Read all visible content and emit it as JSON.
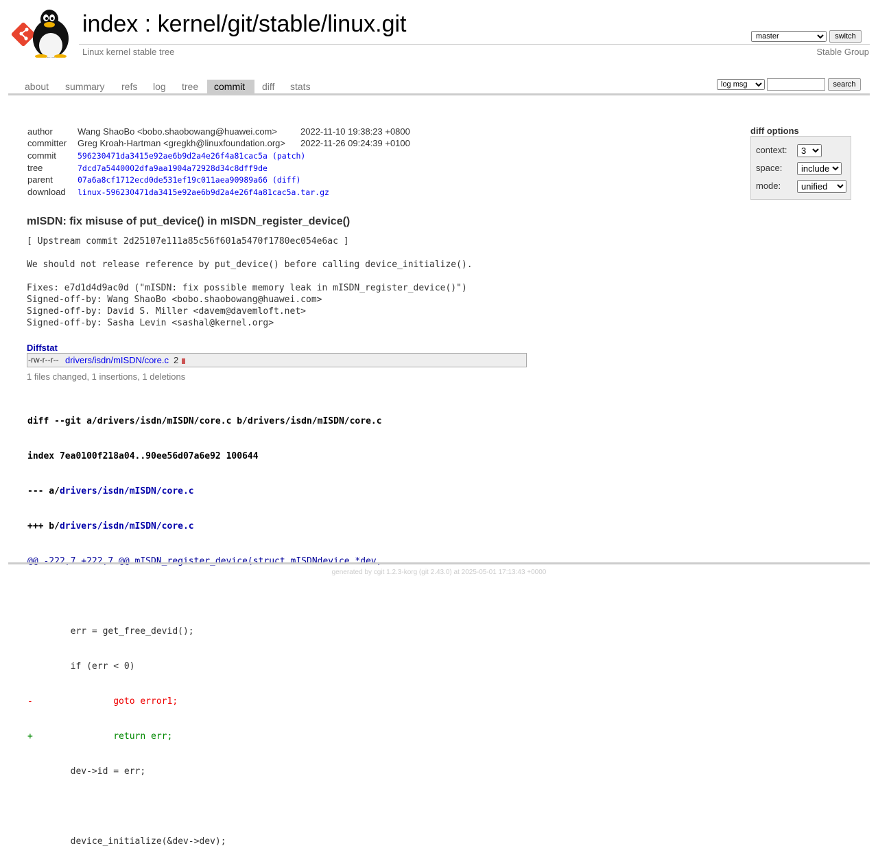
{
  "header": {
    "title_index": "index",
    "title_sep": " : ",
    "title_repo": "kernel/git/stable/linux.git",
    "subtitle": "Linux kernel stable tree",
    "owner": "Stable Group",
    "branch": "master",
    "switch_label": "switch"
  },
  "tabs": [
    {
      "label": "about"
    },
    {
      "label": "summary"
    },
    {
      "label": "refs"
    },
    {
      "label": "log"
    },
    {
      "label": "tree"
    },
    {
      "label": "commit"
    },
    {
      "label": "diff"
    },
    {
      "label": "stats"
    }
  ],
  "search": {
    "select_value": "log msg",
    "input_value": "",
    "button_label": "search"
  },
  "diff_options": {
    "title": "diff options",
    "context_label": "context:",
    "context_value": "3",
    "space_label": "space:",
    "space_value": "include",
    "mode_label": "mode:",
    "mode_value": "unified"
  },
  "commit_info": {
    "author_label": "author",
    "author": "Wang ShaoBo <bobo.shaobowang@huawei.com>",
    "author_date": "2022-11-10 19:38:23 +0800",
    "committer_label": "committer",
    "committer": "Greg Kroah-Hartman <gregkh@linuxfoundation.org>",
    "committer_date": "2022-11-26 09:24:39 +0100",
    "commit_label": "commit",
    "commit": "596230471da3415e92ae6b9d2a4e26f4a81cac5a",
    "patch": "(patch)",
    "tree_label": "tree",
    "tree": "7dcd7a5440002dfa9aa1904a72928d34c8dff9de",
    "parent_label": "parent",
    "parent": "07a6a8cf1712ecd0de531ef19c011aea90989a66",
    "parent_diff": "(diff)",
    "download_label": "download",
    "download": "linux-596230471da3415e92ae6b9d2a4e26f4a81cac5a.tar.gz"
  },
  "commit_subject": "mISDN: fix misuse of put_device() in mISDN_register_device()",
  "commit_message": "[ Upstream commit 2d25107e111a85c56f601a5470f1780ec054e6ac ]\n\nWe should not release reference by put_device() before calling device_initialize().\n\nFixes: e7d1d4d9ac0d (\"mISDN: fix possible memory leak in mISDN_register_device()\")\nSigned-off-by: Wang ShaoBo <bobo.shaobowang@huawei.com>\nSigned-off-by: David S. Miller <davem@davemloft.net>\nSigned-off-by: Sasha Levin <sashal@kernel.org>",
  "diffstat": {
    "header": "Diffstat",
    "mode": "-rw-r--r--",
    "file": "drivers/isdn/mISDN/core.c",
    "count": "2",
    "insertions": 1,
    "deletions": 1,
    "summary": "1 files changed, 1 insertions, 1 deletions"
  },
  "diff": {
    "line1": "diff --git a/drivers/isdn/mISDN/core.c b/drivers/isdn/mISDN/core.c",
    "line2": "index 7ea0100f218a04..90ee56d07a6e92 100644",
    "minus_prefix": "--- a/",
    "plus_prefix": "+++ b/",
    "file": "drivers/isdn/mISDN/core.c",
    "hunk": "@@ -222,7 +222,7 @@ mISDN_register_device(struct mISDNdevice *dev,",
    "body": [
      {
        "type": "ctx",
        "text": ""
      },
      {
        "type": "ctx",
        "text": "        err = get_free_devid();"
      },
      {
        "type": "ctx",
        "text": "        if (err < 0)"
      },
      {
        "type": "del",
        "text": "-               goto error1;"
      },
      {
        "type": "add",
        "text": "+               return err;"
      },
      {
        "type": "ctx",
        "text": "        dev->id = err;"
      },
      {
        "type": "ctx",
        "text": ""
      },
      {
        "type": "ctx",
        "text": "        device_initialize(&dev->dev);"
      }
    ]
  },
  "footer": {
    "prefix": "generated by ",
    "cgit": "cgit 1.2.3-korg",
    "git": " (git 2.43.0)",
    "suffix": " at 2025-05-01 17:13:43 +0000"
  },
  "colors": {
    "link": "#0000ee",
    "active_tab_bg": "#cccccc",
    "diff_add": "#008800",
    "diff_del": "#ee0000",
    "hunk": "#000099"
  }
}
